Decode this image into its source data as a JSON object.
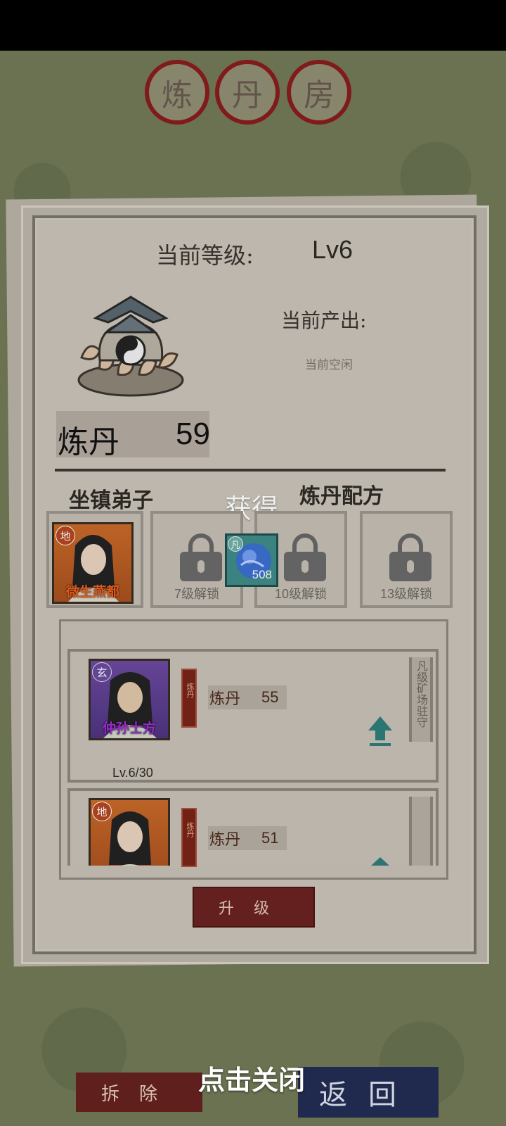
{
  "title_seals": [
    "炼",
    "丹",
    "房"
  ],
  "level": {
    "label": "当前等级:",
    "value": "Lv6"
  },
  "output": {
    "label": "当前产出:",
    "status": "当前空闲"
  },
  "alchemy_stat": {
    "label": "炼丹",
    "value": "59"
  },
  "sections": {
    "garrison": "坐镇弟子",
    "recipe": "炼丹配方"
  },
  "obtained": "获得",
  "garrison_disciple": {
    "grade": "地",
    "name": "微生燕都"
  },
  "reward_item": {
    "grade": "凡",
    "count": "508"
  },
  "locked_slots": [
    "7级解锁",
    "10级解锁",
    "13级解锁"
  ],
  "disciples": [
    {
      "grade": "玄",
      "name": "仲孙士方",
      "tab": "炼丹",
      "stat_label": "炼丹",
      "stat_value": "55",
      "level": "Lv.6/30",
      "scroll_text": "凡级矿场驻守"
    },
    {
      "grade": "地",
      "name": "",
      "tab": "炼丹",
      "stat_label": "炼丹",
      "stat_value": "51",
      "level": "",
      "scroll_text": ""
    }
  ],
  "buttons": {
    "upgrade": "升级",
    "demolish": "拆除",
    "back": "返回",
    "close_hint": "点击关闭"
  },
  "colors": {
    "seal_red": "#8a1c1c",
    "upgrade_btn": "#6b2320",
    "back_btn": "#1f2a4e",
    "teal_arrow": "#2e7d7a"
  }
}
